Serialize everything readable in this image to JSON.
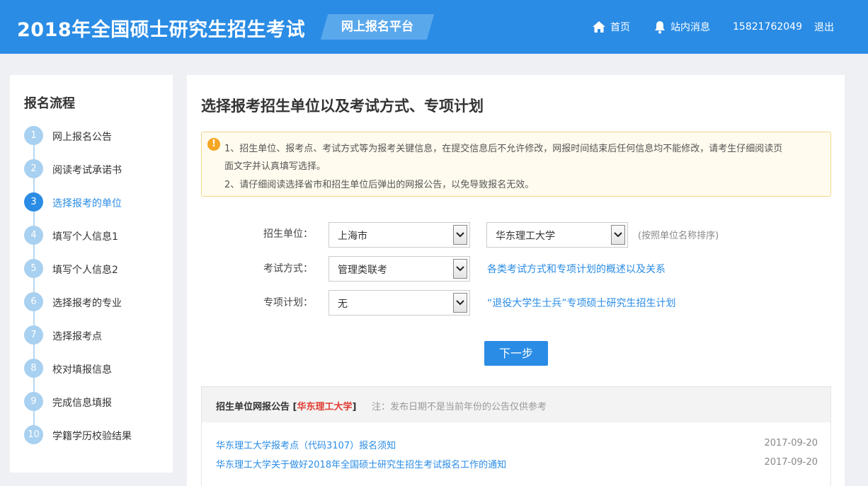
{
  "header": {
    "title": "2018年全国硕士研究生招生考试",
    "platform": "网上报名平台",
    "home": "首页",
    "messages": "站内消息",
    "phone": "15821762049",
    "logout": "退出"
  },
  "sidebar": {
    "title": "报名流程",
    "current_step": 3,
    "steps": [
      {
        "num": "1",
        "label": "网上报名公告"
      },
      {
        "num": "2",
        "label": "阅读考试承诺书"
      },
      {
        "num": "3",
        "label": "选择报考的单位"
      },
      {
        "num": "4",
        "label": "填写个人信息1"
      },
      {
        "num": "5",
        "label": "填写个人信息2"
      },
      {
        "num": "6",
        "label": "选择报考的专业"
      },
      {
        "num": "7",
        "label": "选择报考点"
      },
      {
        "num": "8",
        "label": "校对填报信息"
      },
      {
        "num": "9",
        "label": "完成信息填报"
      },
      {
        "num": "10",
        "label": "学籍学历校验结果"
      }
    ]
  },
  "main": {
    "title": "选择报考招生单位以及考试方式、专项计划",
    "notice": {
      "line1": "1、招生单位、报考点、考试方式等为报考关键信息，在提交信息后不允许修改，网报时间结束后任何信息均不能修改，请考生仔细阅读页",
      "line2": "面文字并认真填写选择。",
      "line3": "2、请仔细阅读选择省市和招生单位后弹出的网报公告，以免导致报名无效。"
    },
    "form": {
      "unit_label": "招生单位：",
      "province_value": "上海市",
      "school_value": "华东理工大学",
      "sort_hint": "(按照单位名称排序)",
      "exam_label": "考试方式：",
      "exam_value": "管理类联考",
      "exam_link": "各类考试方式和专项计划的概述以及关系",
      "plan_label": "专项计划：",
      "plan_value": "无",
      "plan_link": "“退役大学生士兵”专项硕士研究生招生计划"
    },
    "next_button": "下一步",
    "announcements": {
      "head_prefix": "招生单位网报公告 [",
      "head_school": "华东理工大学",
      "head_suffix": "]",
      "note": "注：发布日期不是当前年份的公告仅供参考",
      "items": [
        {
          "title": "华东理工大学报考点（代码3107）报名须知",
          "date": "2017-09-20"
        },
        {
          "title": "华东理工大学关于做好2018年全国硕士研究生招生考试报名工作的通知",
          "date": "2017-09-20"
        }
      ]
    }
  }
}
